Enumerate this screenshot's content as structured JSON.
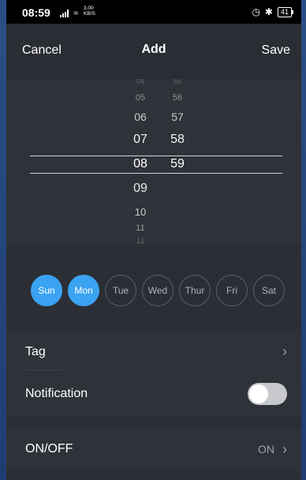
{
  "status_bar": {
    "time": "08:59",
    "signal_icon": "signal-bars-icon",
    "wifi_icon": "wifi-icon",
    "speed_value": "3.00",
    "speed_unit": "KB/S",
    "alarm_icon": "alarm-icon",
    "bluetooth_icon": "bluetooth-icon",
    "battery": "41"
  },
  "header": {
    "cancel_label": "Cancel",
    "title": "Add",
    "save_label": "Save"
  },
  "picker": {
    "hours": [
      "04",
      "05",
      "06",
      "07",
      "08",
      "09",
      "10",
      "11",
      "12"
    ],
    "minutes": [
      "55",
      "56",
      "57",
      "58",
      "59"
    ],
    "selected_hour": "08",
    "selected_minute": "59"
  },
  "days": [
    {
      "label": "Sun",
      "selected": true
    },
    {
      "label": "Mon",
      "selected": true
    },
    {
      "label": "Tue",
      "selected": false
    },
    {
      "label": "Wed",
      "selected": false
    },
    {
      "label": "Thur",
      "selected": false
    },
    {
      "label": "Fri",
      "selected": false
    },
    {
      "label": "Sat",
      "selected": false
    }
  ],
  "tag": {
    "label": "Tag",
    "chevron_icon": "chevron-right-icon"
  },
  "notification": {
    "label": "Notification",
    "enabled": false
  },
  "onoff": {
    "label": "ON/OFF",
    "value": "ON",
    "chevron_icon": "chevron-right-icon"
  },
  "colors": {
    "accent": "#3aa3f2",
    "background": "#2b2e35",
    "row_background": "#2f3238",
    "status_bar": "#000000",
    "muted_text": "#9da1a8"
  }
}
